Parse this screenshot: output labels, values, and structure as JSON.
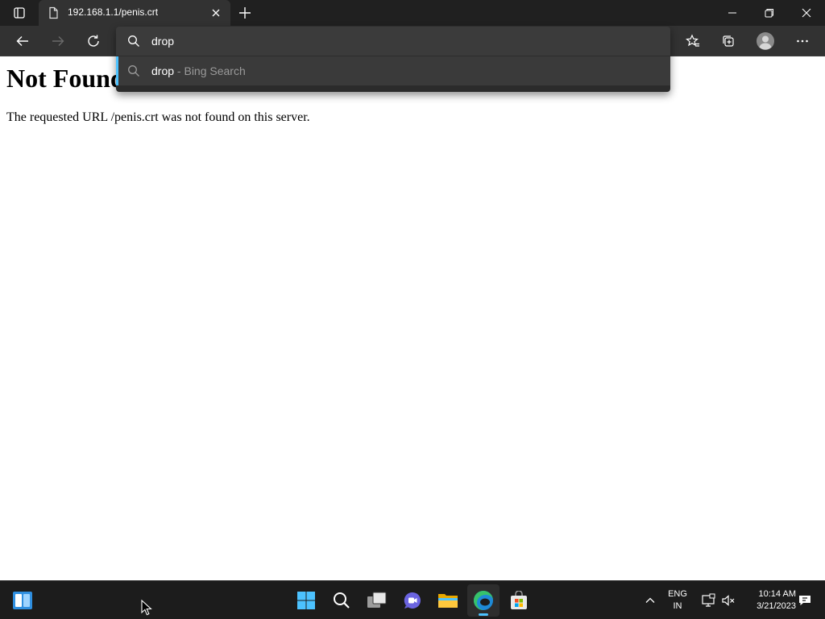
{
  "browser": {
    "tab": {
      "title": "192.168.1.1/penis.crt",
      "favicon": "page-icon"
    },
    "tab_actions_icon": "tab-actions-icon",
    "new_tab_icon": "plus-icon",
    "window_controls": [
      "minimize-icon",
      "restore-icon",
      "close-icon"
    ],
    "toolbar": {
      "back_icon": "back-arrow-icon",
      "forward_icon": "forward-arrow-icon",
      "reload_icon": "reload-icon",
      "favorites_icon": "favorites-icon",
      "collections_icon": "collections-icon",
      "profile_icon": "profile-icon",
      "menu_icon": "more-icon"
    },
    "address_bar": {
      "value": "drop",
      "suggestions": [
        {
          "term": "drop",
          "separator": " - ",
          "engine": "Bing Search"
        }
      ]
    }
  },
  "page": {
    "heading": "Not Found",
    "message": "The requested URL /penis.crt was not found on this server."
  },
  "taskbar": {
    "apps": [
      "widgets-icon",
      "start-icon",
      "search-icon",
      "task-view-icon",
      "chat-icon",
      "file-explorer-icon",
      "edge-icon",
      "store-icon"
    ],
    "active_app": "edge-icon",
    "tray": {
      "language_line1": "ENG",
      "language_line2": "IN",
      "time": "10:14 AM",
      "date": "3/21/2023"
    }
  },
  "colors": {
    "accent": "#4cc2ff",
    "chrome_dark": "#202020",
    "toolbar": "#323232",
    "taskbar": "#1c1c1c"
  }
}
